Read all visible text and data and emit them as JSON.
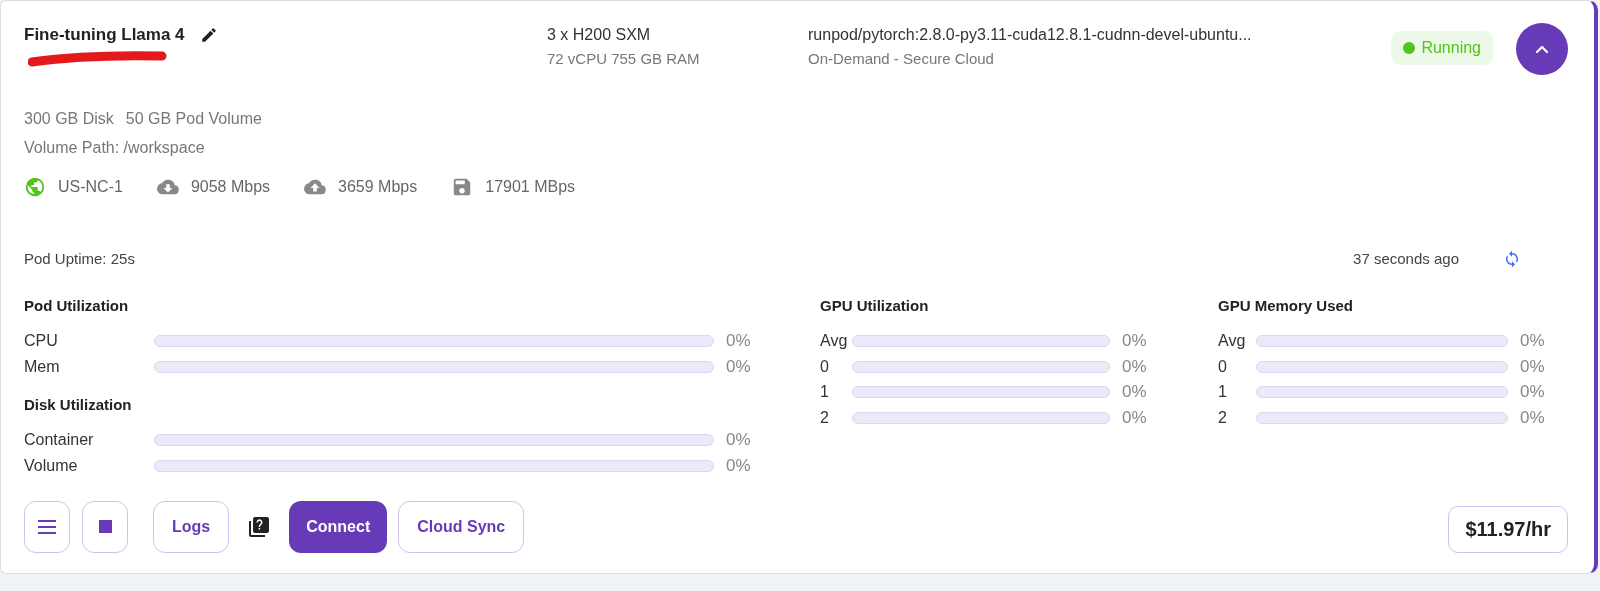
{
  "pod": {
    "name": "Fine-tuning Llama 4",
    "gpu": "3 x H200 SXM",
    "specs": "72 vCPU 755 GB RAM",
    "image": "runpod/pytorch:2.8.0-py3.11-cuda12.8.1-cudnn-devel-ubuntu...",
    "cloud": "On-Demand - Secure Cloud",
    "status": {
      "label": "Running",
      "kind": "running"
    },
    "expanded": true
  },
  "storage": [
    "300 GB Disk",
    "50 GB Pod Volume"
  ],
  "volume_path": "Volume Path: /workspace",
  "network": [
    {
      "kind": "region",
      "label": "US-NC-1"
    },
    {
      "kind": "download",
      "label": "9058 Mbps"
    },
    {
      "kind": "upload",
      "label": "3659 Mbps"
    },
    {
      "kind": "disk",
      "label": "17901 MBps"
    }
  ],
  "uptime": "Pod Uptime: 25s",
  "updated": "37 seconds ago",
  "metric_columns": [
    [
      {
        "title": "Pod Utilization",
        "rows": [
          {
            "label": "CPU",
            "level": 0,
            "reading": "0%"
          },
          {
            "label": "Mem",
            "level": 0,
            "reading": "0%"
          }
        ]
      },
      {
        "title": "Disk Utilization",
        "rows": [
          {
            "label": "Container",
            "level": 0,
            "reading": "0%"
          },
          {
            "label": "Volume",
            "level": 0,
            "reading": "0%"
          }
        ]
      }
    ],
    [
      {
        "title": "GPU Utilization",
        "rows": [
          {
            "label": "Avg",
            "level": 0,
            "reading": "0%"
          },
          {
            "label": "0",
            "level": 0,
            "reading": "0%"
          },
          {
            "label": "1",
            "level": 0,
            "reading": "0%"
          },
          {
            "label": "2",
            "level": 0,
            "reading": "0%"
          }
        ]
      }
    ],
    [
      {
        "title": "GPU Memory Used",
        "rows": [
          {
            "label": "Avg",
            "level": 0,
            "reading": "0%"
          },
          {
            "label": "0",
            "level": 0,
            "reading": "0%"
          },
          {
            "label": "1",
            "level": 0,
            "reading": "0%"
          },
          {
            "label": "2",
            "level": 0,
            "reading": "0%"
          }
        ]
      }
    ]
  ],
  "actions": [
    {
      "kind": "menu"
    },
    {
      "kind": "stop"
    },
    {
      "kind": "outline",
      "label": "Logs"
    },
    {
      "kind": "help"
    },
    {
      "kind": "primary",
      "label": "Connect"
    },
    {
      "kind": "outline",
      "label": "Cloud Sync"
    }
  ],
  "price": "$11.97/hr"
}
